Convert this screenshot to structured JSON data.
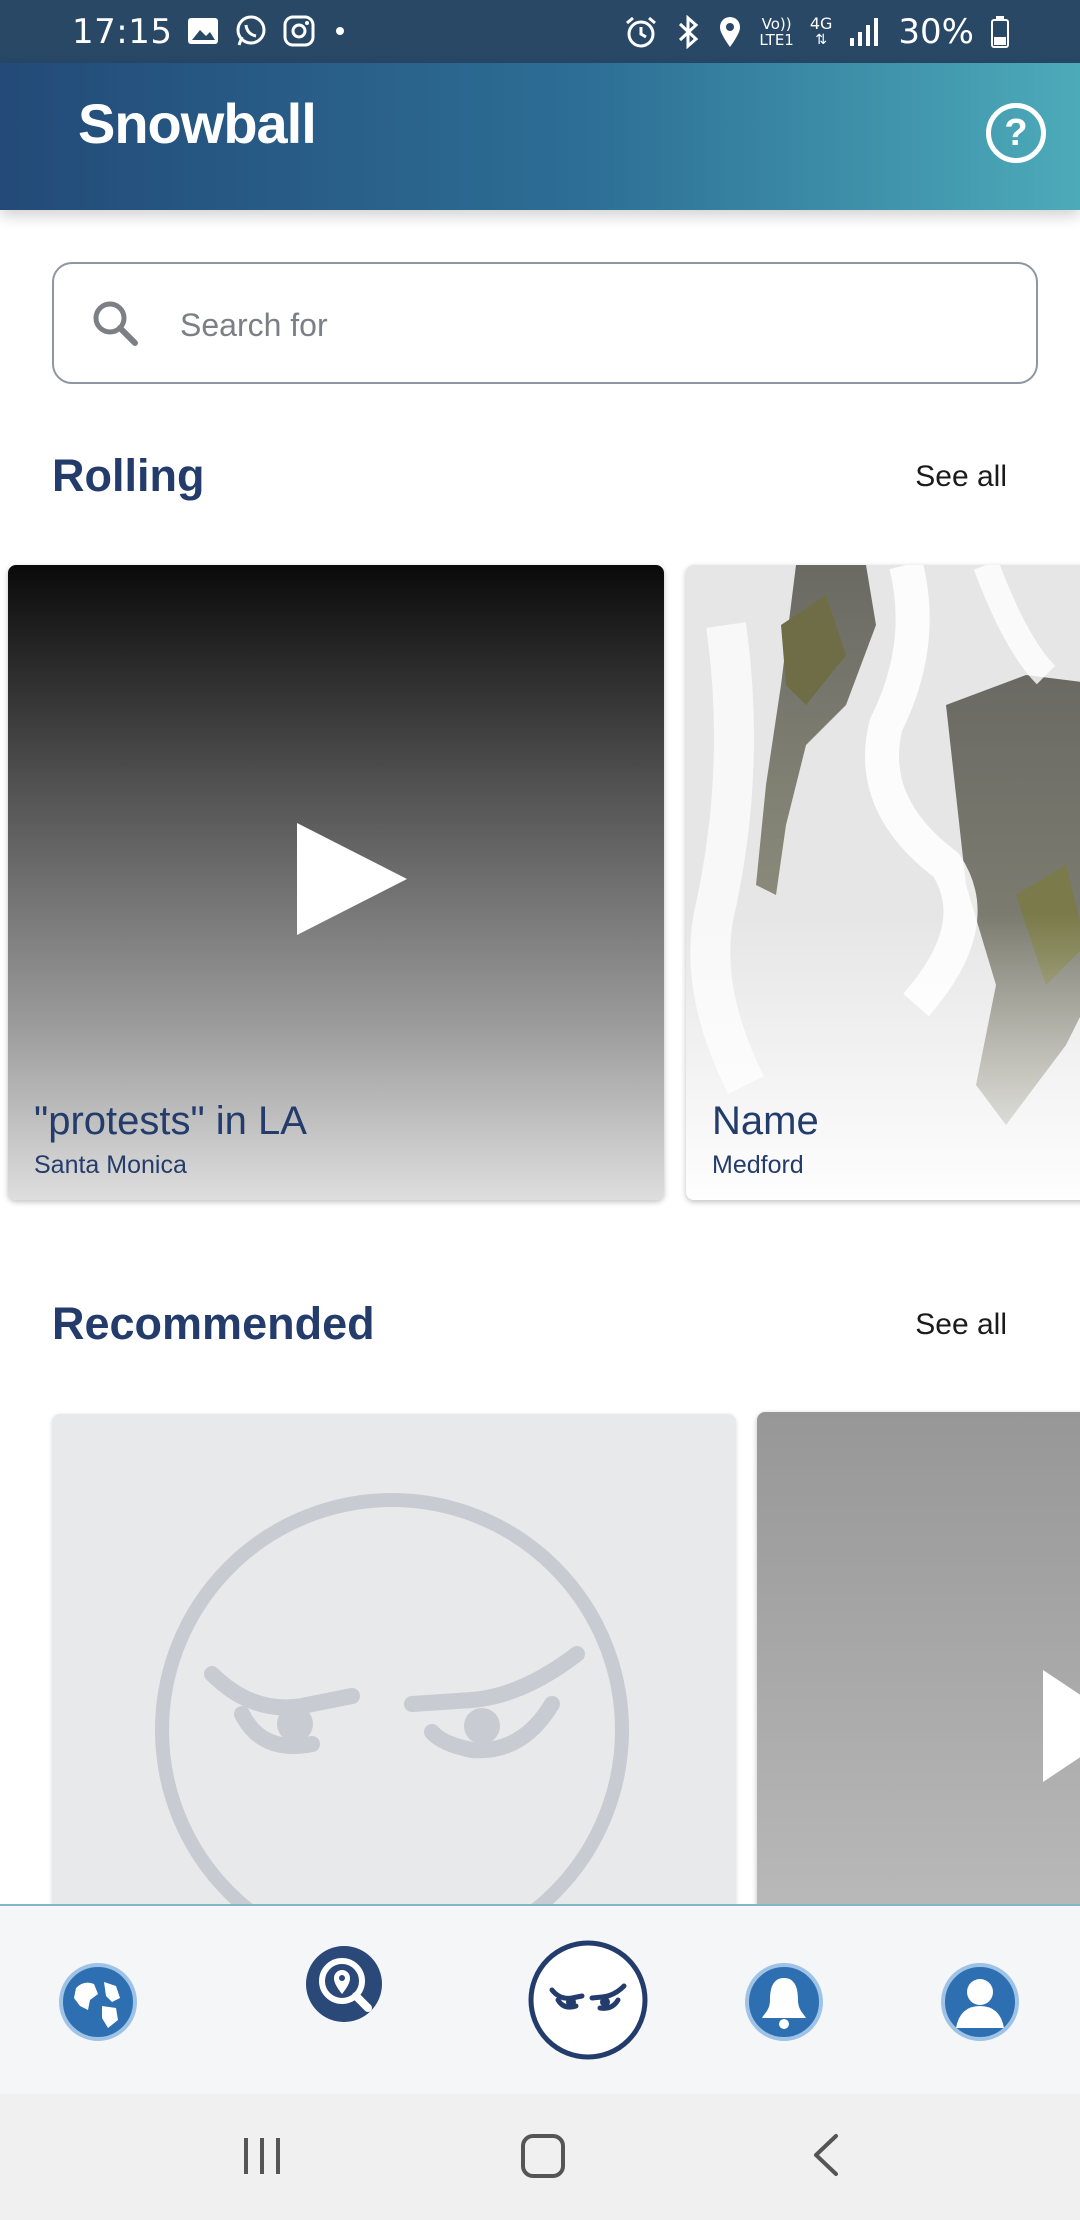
{
  "status_bar": {
    "time": "17:15",
    "battery": "30%",
    "left_icons": [
      "gallery-icon",
      "whatsapp-icon",
      "instagram-icon",
      "dot-icon"
    ],
    "right_icons": [
      "alarm-icon",
      "bluetooth-icon",
      "location-icon",
      "volte-icon",
      "4g-icon",
      "signal-icon",
      "battery-icon"
    ],
    "network_labels": {
      "volte": "Vo))",
      "lte": "LTE1",
      "net": "4G"
    }
  },
  "header": {
    "logo_text": "Snowball",
    "help_label": "?"
  },
  "search": {
    "placeholder": "Search for",
    "value": ""
  },
  "rolling": {
    "title": "Rolling",
    "see_all": "See all",
    "cards": [
      {
        "title": "\"protests\" in LA",
        "subtitle": "Santa Monica",
        "media": "video"
      },
      {
        "title": "Name",
        "subtitle": "Medford",
        "media": "photo"
      }
    ]
  },
  "recommended": {
    "title": "Recommended",
    "see_all": "See all",
    "cards": [
      {
        "media": "placeholder-face"
      },
      {
        "media": "video"
      }
    ]
  },
  "bottom_nav": {
    "items": [
      "globe-icon",
      "search-location-icon",
      "snowball-face-icon",
      "bell-icon",
      "profile-icon"
    ],
    "active": "snowball-face-icon"
  },
  "system_nav": {
    "items": [
      "recent-apps-icon",
      "home-icon",
      "back-icon"
    ]
  },
  "colors": {
    "primary": "#233c6b",
    "header_start": "#234a78",
    "header_end": "#4cabb9",
    "nav_accent": "#7fb8c6"
  }
}
